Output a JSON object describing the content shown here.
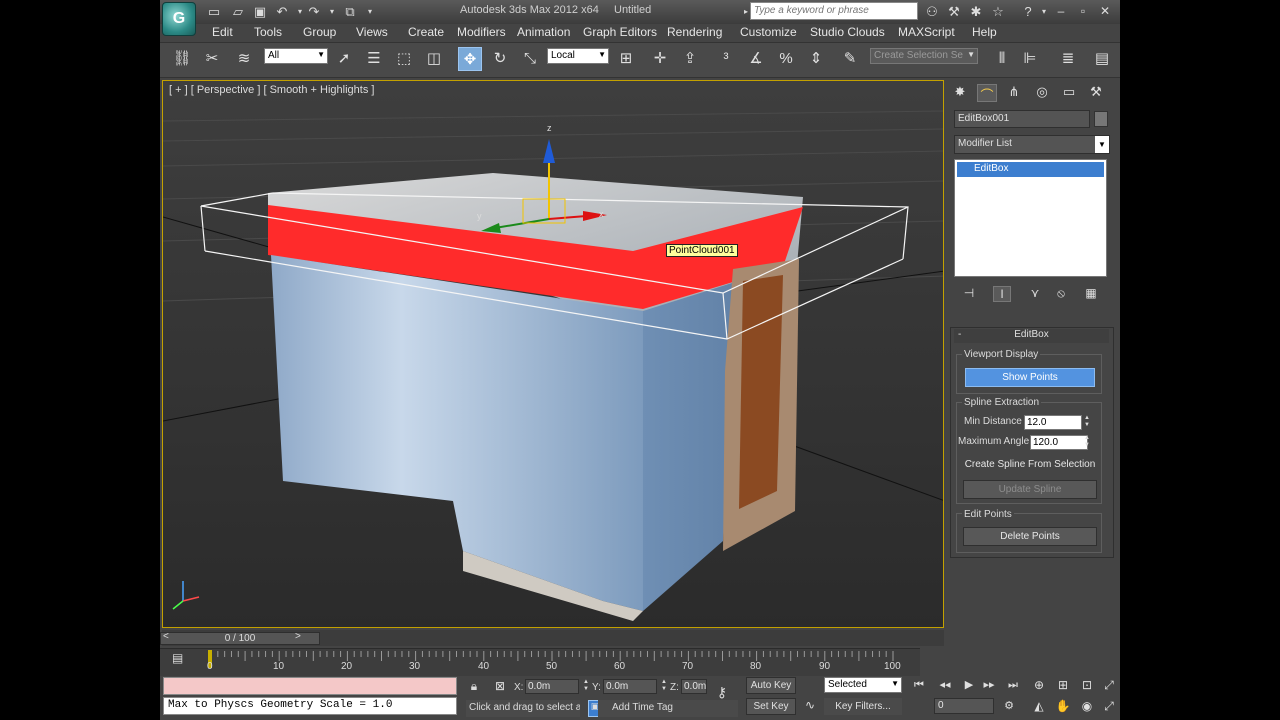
{
  "title_bar": {
    "app_title": "Autodesk 3ds Max  2012 x64",
    "document_name": "Untitled",
    "search_placeholder": "Type a keyword or phrase",
    "logo_text": "G",
    "quick_access_icons": [
      "new-icon",
      "open-icon",
      "save-icon",
      "undo-icon",
      "redo-icon",
      "project-folder-icon"
    ],
    "help_icons": [
      "binoculars-icon",
      "tools-icon",
      "star-icon",
      "help-icon"
    ]
  },
  "menu": {
    "items": [
      "Edit",
      "Tools",
      "Group",
      "Views",
      "Create",
      "Modifiers",
      "Animation",
      "Graph Editors",
      "Rendering",
      "Customize",
      "Studio Clouds",
      "MAXScript",
      "Help"
    ]
  },
  "toolbar": {
    "selection_filter": "All",
    "coordinate_system": "Local",
    "named_selection_placeholder": "Create Selection Se"
  },
  "viewport": {
    "label": "[ + ] [ Perspective ] [ Smooth + Highlights ]",
    "tooltip": "PointCloud001",
    "gizmo_axis_z": "z",
    "gizmo_axis_x": "x",
    "gizmo_axis_y": "y"
  },
  "command_panel": {
    "tabs": [
      "create-tab",
      "modify-tab",
      "hierarchy-tab",
      "motion-tab",
      "display-tab",
      "utilities-tab"
    ],
    "object_name": "EditBox001",
    "modifier_list": "Modifier List",
    "stack_item": "EditBox",
    "rollout_title": "EditBox",
    "rollout_minus": "-",
    "viewport_display_label": "Viewport Display",
    "show_points": "Show Points",
    "spline_extraction_label": "Spline Extraction",
    "min_distance_label": "Min Distance",
    "min_distance_value": "12.0",
    "max_angle_label": "Maximum Angle",
    "max_angle_value": "120.0",
    "create_spline": "Create Spline From Selection",
    "update_spline": "Update Spline",
    "edit_points_label": "Edit Points",
    "delete_points": "Delete Points"
  },
  "time_slider": {
    "frame_display": "0 / 100",
    "prev": "<",
    "next": ">"
  },
  "track_bar": {
    "ticks": [
      "0",
      "10",
      "20",
      "30",
      "40",
      "50",
      "60",
      "70",
      "80",
      "90",
      "100"
    ]
  },
  "status": {
    "listener_output": "Max to Physcs Geometry Scale = 1.0",
    "x_label": "X:",
    "x_value": "0.0m",
    "y_label": "Y:",
    "y_value": "0.0m",
    "z_label": "Z:",
    "z_value": "0.0m",
    "prompt": "Click and drag to select a",
    "add_time_tag": "Add Time Tag",
    "auto_key": "Auto Key",
    "set_key": "Set Key",
    "selected": "Selected",
    "key_filters": "Key Filters...",
    "current_frame": "0"
  }
}
